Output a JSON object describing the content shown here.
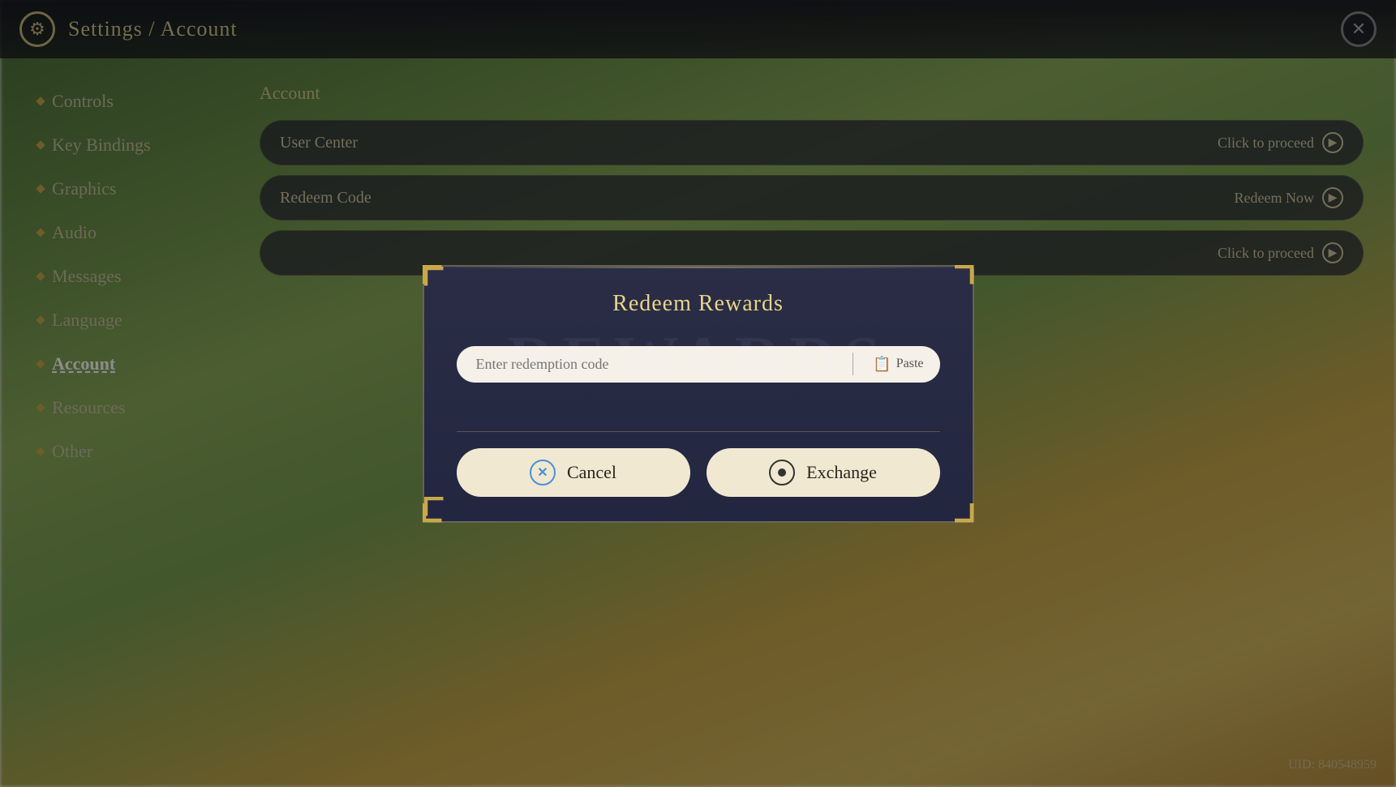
{
  "topbar": {
    "title": "Settings / Account",
    "close_label": "✕"
  },
  "sidebar": {
    "items": [
      {
        "id": "controls",
        "label": "Controls",
        "active": false
      },
      {
        "id": "key-bindings",
        "label": "Key Bindings",
        "active": false
      },
      {
        "id": "graphics",
        "label": "Graphics",
        "active": false
      },
      {
        "id": "audio",
        "label": "Audio",
        "active": false
      },
      {
        "id": "messages",
        "label": "Messages",
        "active": false
      },
      {
        "id": "language",
        "label": "Language",
        "active": false
      },
      {
        "id": "account",
        "label": "Account",
        "active": true
      },
      {
        "id": "resources",
        "label": "Resources",
        "active": false
      },
      {
        "id": "other",
        "label": "Other",
        "active": false
      }
    ]
  },
  "content": {
    "title": "Account",
    "rows": [
      {
        "label": "User Center",
        "action": "Click to proceed"
      },
      {
        "label": "Redeem Code",
        "action": "Redeem Now"
      },
      {
        "label": "",
        "action": "Click to proceed"
      }
    ]
  },
  "dialog": {
    "title": "Redeem Rewards",
    "watermark": "REWARDS",
    "input_placeholder": "Enter redemption code",
    "paste_label": "Paste",
    "cancel_label": "Cancel",
    "exchange_label": "Exchange"
  },
  "uid": {
    "label": "UID: 840548959"
  }
}
